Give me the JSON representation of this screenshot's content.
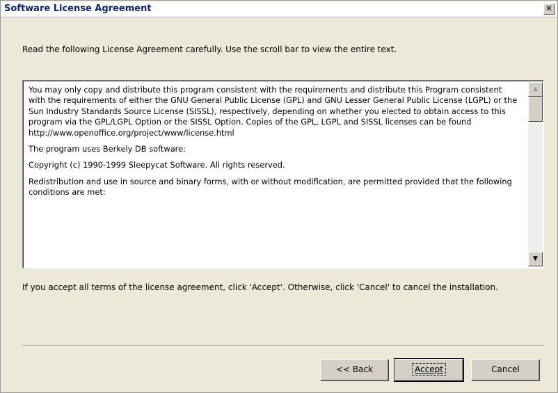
{
  "window": {
    "title": "Software License Agreement",
    "close_glyph": "✕"
  },
  "instruction": "Read the following License Agreement carefully. Use the scroll bar to view the entire text.",
  "license": {
    "paragraphs": [
      "You may only copy and distribute this program consistent with the requirements and distribute this Program consistent with the requirements of either the GNU General Public License (GPL) and GNU Lesser General Public License (LGPL) or the Sun Industry Standards Source License (SISSL), respectively, depending on whether you elected to obtain access to this program via the GPL/LGPL Option or the SISSL Option. Copies of the GPL, LGPL and SISSL licenses can be found http://www.openoffice.org/project/www/license.html",
      "The program uses Berkely DB software:",
      "Copyright (c) 1990-1999 Sleepycat Software.  All rights reserved.",
      "Redistribution and use in source and binary forms, with or without modification, are permitted provided that the following conditions are met:"
    ],
    "scroll_up_glyph": "▲",
    "scroll_down_glyph": "▼"
  },
  "accept_info": "If you accept all terms of the license agreement, click 'Accept'. Otherwise, click 'Cancel' to cancel the installation.",
  "buttons": {
    "back": "<< Back",
    "accept": "Accept",
    "cancel": "Cancel"
  }
}
